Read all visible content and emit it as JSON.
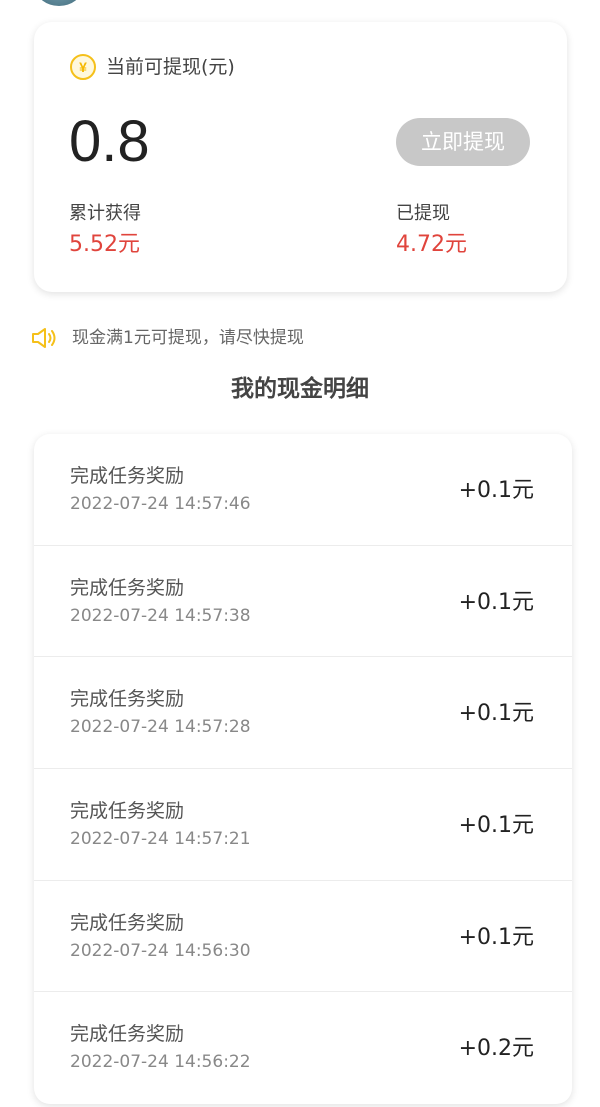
{
  "balance": {
    "title": "当前可提现(元)",
    "coin_symbol": "¥",
    "amount": "0.8",
    "withdraw_button": "立即提现",
    "total_earned_label": "累计获得",
    "total_earned_value": "5.52元",
    "withdrawn_label": "已提现",
    "withdrawn_value": "4.72元"
  },
  "notice": {
    "text": "现金满1元可提现，请尽快提现"
  },
  "section_title": "我的现金明细",
  "records": [
    {
      "title": "完成任务奖励",
      "time": "2022-07-24 14:57:46",
      "amount": "+0.1元"
    },
    {
      "title": "完成任务奖励",
      "time": "2022-07-24 14:57:38",
      "amount": "+0.1元"
    },
    {
      "title": "完成任务奖励",
      "time": "2022-07-24 14:57:28",
      "amount": "+0.1元"
    },
    {
      "title": "完成任务奖励",
      "time": "2022-07-24 14:57:21",
      "amount": "+0.1元"
    },
    {
      "title": "完成任务奖励",
      "time": "2022-07-24 14:56:30",
      "amount": "+0.1元"
    },
    {
      "title": "完成任务奖励",
      "time": "2022-07-24 14:56:22",
      "amount": "+0.2元"
    }
  ],
  "colors": {
    "accent_red": "#e0443c",
    "coin_yellow": "#f5c01a",
    "button_disabled": "#c8c8c8"
  },
  "icons": {
    "coin": "coin-icon",
    "speaker": "speaker-icon"
  }
}
